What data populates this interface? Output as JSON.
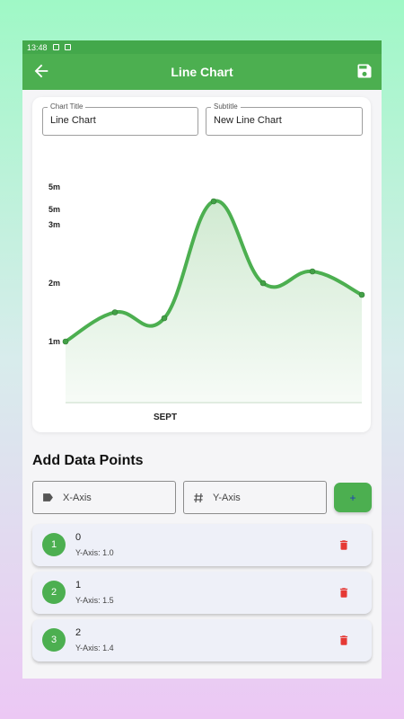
{
  "status": {
    "time": "13:48"
  },
  "appbar": {
    "title": "Line Chart",
    "back_icon": "arrow-left-icon",
    "save_icon": "save-icon"
  },
  "form": {
    "chart_title_label": "Chart Title",
    "chart_title_value": "Line Chart",
    "subtitle_label": "Subtitle",
    "subtitle_value": "New Line Chart"
  },
  "chart_data": {
    "type": "line",
    "x": [
      0,
      1,
      2,
      3,
      4,
      5,
      6
    ],
    "values": [
      1.0,
      1.5,
      1.4,
      3.4,
      2.0,
      2.2,
      1.8
    ],
    "ytick_labels": [
      "5m",
      "5m",
      "3m",
      "2m",
      "1m"
    ],
    "ytick_values": [
      5.0,
      4.0,
      3.0,
      2.0,
      1.0
    ],
    "xtick_label": "SEPT",
    "smooth": true,
    "area_fill": true,
    "line_color": "#4caf50",
    "fill_color": "#c8e6c9"
  },
  "add_section": {
    "title": "Add Data Points",
    "x_placeholder": "X-Axis",
    "y_placeholder": "Y-Axis",
    "add_label": "+"
  },
  "points": [
    {
      "index": "1",
      "x": "0",
      "y_text": "Y-Axis: 1.0"
    },
    {
      "index": "2",
      "x": "1",
      "y_text": "Y-Axis: 1.5"
    },
    {
      "index": "3",
      "x": "2",
      "y_text": "Y-Axis: 1.4"
    }
  ],
  "colors": {
    "primary": "#4caf50",
    "delete": "#e53935"
  }
}
